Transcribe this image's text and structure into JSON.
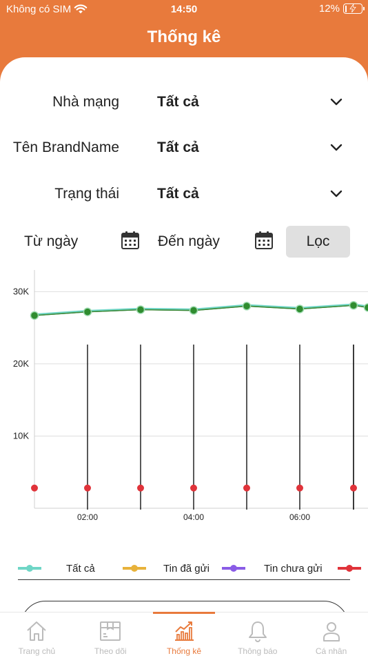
{
  "status_bar": {
    "carrier": "Không có SIM",
    "time": "14:50",
    "battery": "12%",
    "battery_level": 0.12
  },
  "header": {
    "title": "Thống kê"
  },
  "filters": [
    {
      "label": "Nhà mạng",
      "value": "Tất cả"
    },
    {
      "label": "Tên BrandName",
      "value": "Tất cả"
    },
    {
      "label": "Trạng thái",
      "value": "Tất cả"
    }
  ],
  "date_range": {
    "from_label": "Từ ngày",
    "to_label": "Đến ngày",
    "filter_button": "Lọc"
  },
  "chart_data": {
    "type": "line",
    "x": [
      "01:00",
      "02:00",
      "03:00",
      "04:00",
      "05:00",
      "06:00",
      "07:00"
    ],
    "x_tick_labels": [
      "02:00",
      "04:00",
      "06:00"
    ],
    "y_tick_labels": [
      "10K",
      "20K",
      "30K"
    ],
    "ylim": [
      0,
      30000
    ],
    "grid": true,
    "series": [
      {
        "name": "Tất cả",
        "color": "#6fd6c6",
        "values": [
          26800,
          27300,
          27600,
          27500,
          28100,
          27700,
          28200,
          27900
        ]
      },
      {
        "name": "Tin đã gửi",
        "color": "#e8b23a",
        "values": [
          26700,
          27200,
          27500,
          27400,
          28000,
          27600,
          28100,
          27800
        ]
      },
      {
        "name": "Tin chưa gửi",
        "color": "#8a5ce6",
        "values": [
          26700,
          27200,
          27500,
          27400,
          28000,
          27600,
          28100,
          27800
        ]
      },
      {
        "name": "",
        "color": "#e0333a",
        "values": [
          2800,
          2800,
          2800,
          2800,
          2800,
          2800,
          2800,
          2800
        ]
      }
    ],
    "legend_position": "bottom"
  },
  "tabs": [
    {
      "label": "Trang chủ",
      "icon": "home-icon",
      "active": false
    },
    {
      "label": "Theo dõi",
      "icon": "box-icon",
      "active": false
    },
    {
      "label": "Thống kê",
      "icon": "chart-icon",
      "active": true
    },
    {
      "label": "Thông báo",
      "icon": "bell-icon",
      "active": false
    },
    {
      "label": "Cá nhân",
      "icon": "user-icon",
      "active": false
    }
  ],
  "colors": {
    "accent": "#e87a3c",
    "inactive": "#bbbbbb"
  }
}
